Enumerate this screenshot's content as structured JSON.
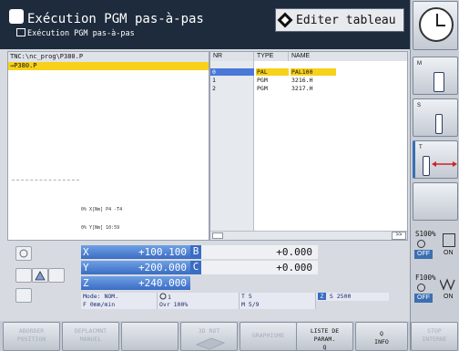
{
  "header": {
    "mode_title": "Exécution PGM pas-à-pas",
    "mode_subtitle": "Exécution PGM pas-à-pas",
    "edit_table_label": "Editer tableau"
  },
  "program": {
    "path": "TNC:\\nc_prog\\P380.P",
    "selected_line": "→P380.P",
    "info_x": "0% X[Nm] P4   -T4",
    "info_y": "0% Y[Nm] 10:59"
  },
  "table": {
    "headers": [
      "NR",
      "TYPE",
      "NAME"
    ],
    "rows": [
      {
        "nr": "0",
        "type": "PAL",
        "name": "PAL100"
      },
      {
        "nr": "1",
        "type": "PGM",
        "name": "3216.H"
      },
      {
        "nr": "2",
        "type": "PGM",
        "name": "3217.H"
      }
    ],
    "scroll_label": ">>"
  },
  "positions": {
    "x_label": "X",
    "x_value": "+100.100",
    "y_label": "Y",
    "y_value": "+200.000",
    "z_label": "Z",
    "z_value": "+240.000",
    "b_label": "B",
    "b_value": "+0.000",
    "c_label": "C",
    "c_value": "+0.000"
  },
  "status": {
    "mode": "Mode: NOM.",
    "tool_dir": "1",
    "feed": "F 0mm/min",
    "ovr": "Ovr 100%",
    "tool": "T 5",
    "spindle_axis": "Z",
    "spindle_speed": "S 2500",
    "m_func": "M 5/9"
  },
  "right_strip": {
    "m_label": "M",
    "s_label": "S",
    "t_label": "T",
    "s_override": "S100%",
    "f_override": "F100%",
    "off_label": "OFF",
    "on_label": "ON"
  },
  "softkeys": [
    {
      "label1": "ABORDER",
      "label2": "POSITION",
      "active": false
    },
    {
      "label1": "DEPLACMNT",
      "label2": "MANUEL",
      "active": false
    },
    {
      "label1": "",
      "label2": "",
      "active": false
    },
    {
      "label1": "3D ROT",
      "label2": "",
      "active": false
    },
    {
      "label1": "GRAPHISME",
      "label2": "",
      "active": false
    },
    {
      "label1": "LISTE DE",
      "label2": "PARAM.",
      "label3": "Q",
      "active": true
    },
    {
      "label1": "Q",
      "label2": "INFO",
      "active": true
    },
    {
      "label1": "STOP",
      "label2": "INTERNE",
      "active": false
    }
  ],
  "colors": {
    "header_bg": "#1d2b3c",
    "selection": "#f7d11a",
    "axis_blue": "#3a6cc4",
    "off_blue": "#3b6fb0"
  }
}
